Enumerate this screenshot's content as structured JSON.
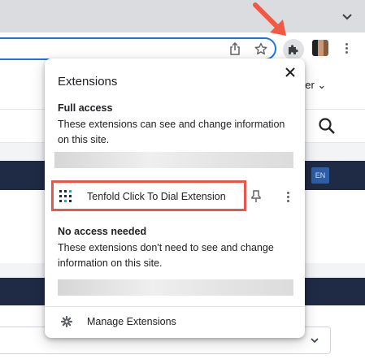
{
  "popup": {
    "title": "Extensions",
    "full_access": {
      "heading": "Full access",
      "description": "These extensions can see and change information on this site."
    },
    "extension": {
      "name": "Tenfold Click To Dial Extension"
    },
    "no_access": {
      "heading": "No access needed",
      "description": "These extensions don't need to see and change information on this site."
    },
    "manage_label": "Manage Extensions"
  },
  "page": {
    "manager_text": "ger",
    "lang_badge": "EN"
  },
  "colors": {
    "highlight": "#e8574a",
    "annotation_arrow": "#f05a44",
    "dark_bar": "#1f2a44",
    "omnibox_focus": "#1a73e8"
  },
  "icons": [
    "chevron-down-icon",
    "share-icon",
    "star-icon",
    "puzzle-icon",
    "kebab-menu-icon",
    "close-icon",
    "tenfold-logo-icon",
    "pin-icon",
    "gear-icon",
    "search-icon"
  ]
}
